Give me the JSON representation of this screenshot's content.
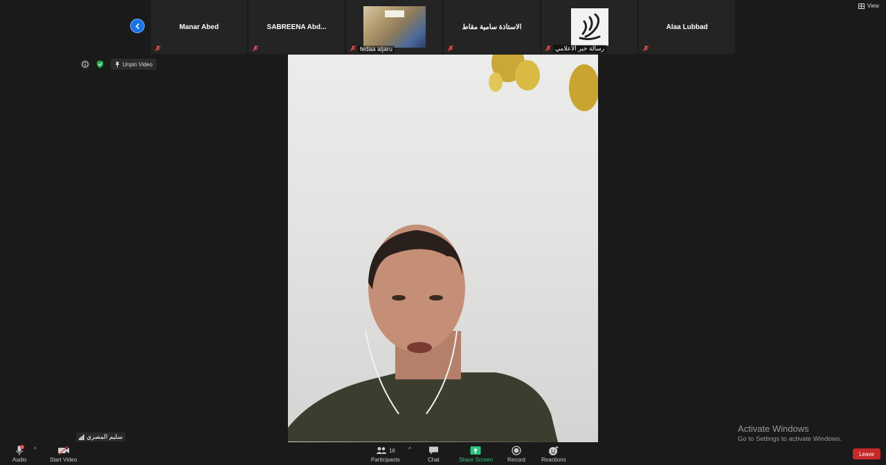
{
  "gallery": {
    "tiles": [
      {
        "name": "Manar Abed"
      },
      {
        "name": "SABREENA Abd..."
      },
      {
        "label": "fedaa aljaru"
      },
      {
        "name": "الاستاذة سامية مقاط"
      },
      {
        "label": "رسالة خير الاعلامي"
      },
      {
        "name": "Alaa Lubbad"
      }
    ]
  },
  "top": {
    "view_label": "View"
  },
  "pinned": {
    "unpin_label": "Unpin Video"
  },
  "self": {
    "name": "سليم المصري"
  },
  "toolbar": {
    "audio_label": "Audio",
    "video_label": "Start Video",
    "participants_label": "Participants",
    "participants_count": "16",
    "chat_label": "Chat",
    "share_label": "Share Screen",
    "record_label": "Record",
    "reactions_label": "Reactions",
    "leave_label": "Leave"
  },
  "watermark": {
    "title": "Activate Windows",
    "subtitle": "Go to Settings to activate Windows."
  },
  "colors": {
    "accent": "#1a73e8",
    "leave": "#c62828",
    "share": "#2ec27e",
    "muted": "#e5484d"
  },
  "icons": [
    "chevron-left-icon",
    "view-grid-icon",
    "info-icon",
    "shield-icon",
    "pin-icon",
    "mic-muted-icon",
    "video-off-icon",
    "participants-icon",
    "chat-icon",
    "share-screen-icon",
    "record-icon",
    "reactions-icon"
  ]
}
